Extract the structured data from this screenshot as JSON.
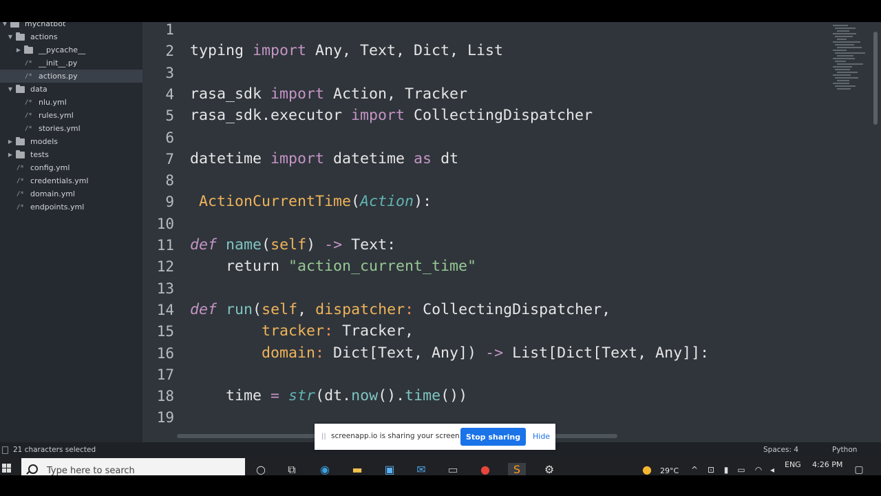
{
  "sidebar": {
    "items": [
      {
        "label": "mychatbot",
        "kind": "folder",
        "open": true,
        "selected": false
      },
      {
        "label": "actions",
        "kind": "folder",
        "open": true,
        "selected": false
      },
      {
        "label": "__pycache__",
        "kind": "folder",
        "open": false,
        "selected": false
      },
      {
        "label": "__init__.py",
        "kind": "file",
        "selected": false
      },
      {
        "label": "actions.py",
        "kind": "file",
        "selected": true
      },
      {
        "label": "data",
        "kind": "folder",
        "open": true,
        "selected": false
      },
      {
        "label": "nlu.yml",
        "kind": "file",
        "selected": false
      },
      {
        "label": "rules.yml",
        "kind": "file",
        "selected": false
      },
      {
        "label": "stories.yml",
        "kind": "file",
        "selected": false
      },
      {
        "label": "models",
        "kind": "folder",
        "open": false,
        "selected": false
      },
      {
        "label": "tests",
        "kind": "folder",
        "open": false,
        "selected": false
      },
      {
        "label": "config.yml",
        "kind": "file",
        "selected": false
      },
      {
        "label": "credentials.yml",
        "kind": "file",
        "selected": false
      },
      {
        "label": "domain.yml",
        "kind": "file",
        "selected": false
      },
      {
        "label": "endpoints.yml",
        "kind": "file",
        "selected": false
      }
    ]
  },
  "editor": {
    "line_numbers": [
      "1",
      "2",
      "3",
      "4",
      "5",
      "6",
      "7",
      "8",
      "9",
      "10",
      "11",
      "12",
      "13",
      "14",
      "15",
      "16",
      "17",
      "18",
      "19"
    ],
    "lines": [
      [],
      [
        {
          "t": "typing ",
          "c": ""
        },
        {
          "t": "import",
          "c": "kw"
        },
        {
          "t": " Any, Text, Dict, List",
          "c": ""
        }
      ],
      [],
      [
        {
          "t": "rasa_sdk ",
          "c": ""
        },
        {
          "t": "import",
          "c": "kw"
        },
        {
          "t": " Action, Tracker",
          "c": ""
        }
      ],
      [
        {
          "t": "rasa_sdk.executor ",
          "c": ""
        },
        {
          "t": "import",
          "c": "kw"
        },
        {
          "t": " CollectingDispatcher",
          "c": ""
        }
      ],
      [],
      [
        {
          "t": "datetime ",
          "c": ""
        },
        {
          "t": "import",
          "c": "kw"
        },
        {
          "t": " datetime ",
          "c": ""
        },
        {
          "t": "as",
          "c": "kw"
        },
        {
          "t": " dt",
          "c": ""
        }
      ],
      [],
      [
        {
          "t": " ",
          "c": ""
        },
        {
          "t": "ActionCurrentTime",
          "c": "cls"
        },
        {
          "t": "(",
          "c": ""
        },
        {
          "t": "Action",
          "c": "it"
        },
        {
          "t": "):",
          "c": ""
        }
      ],
      [],
      [
        {
          "t": "def",
          "c": "itk"
        },
        {
          "t": " ",
          "c": ""
        },
        {
          "t": "name",
          "c": "fn"
        },
        {
          "t": "(",
          "c": ""
        },
        {
          "t": "self",
          "c": "slf"
        },
        {
          "t": ") ",
          "c": ""
        },
        {
          "t": "->",
          "c": "kw"
        },
        {
          "t": " Text:",
          "c": ""
        }
      ],
      [
        {
          "t": "    return ",
          "c": ""
        },
        {
          "t": "\"action_current_time\"",
          "c": "str"
        }
      ],
      [],
      [
        {
          "t": "def",
          "c": "itk"
        },
        {
          "t": " ",
          "c": ""
        },
        {
          "t": "run",
          "c": "fn"
        },
        {
          "t": "(",
          "c": ""
        },
        {
          "t": "self",
          "c": "slf"
        },
        {
          "t": ", ",
          "c": ""
        },
        {
          "t": "dispatcher",
          "c": "slf"
        },
        {
          "t": ":",
          "c": "op"
        },
        {
          "t": " CollectingDispatcher,",
          "c": ""
        }
      ],
      [
        {
          "t": "        ",
          "c": ""
        },
        {
          "t": "tracker",
          "c": "slf"
        },
        {
          "t": ":",
          "c": "op"
        },
        {
          "t": " Tracker,",
          "c": ""
        }
      ],
      [
        {
          "t": "        ",
          "c": ""
        },
        {
          "t": "domain",
          "c": "slf"
        },
        {
          "t": ":",
          "c": "op"
        },
        {
          "t": " Dict[Text, Any]) ",
          "c": ""
        },
        {
          "t": "->",
          "c": "kw"
        },
        {
          "t": " List[Dict[Text, Any]]:",
          "c": ""
        }
      ],
      [],
      [
        {
          "t": "    time ",
          "c": ""
        },
        {
          "t": "=",
          "c": "kw"
        },
        {
          "t": " ",
          "c": ""
        },
        {
          "t": "str",
          "c": "it"
        },
        {
          "t": "(dt.",
          "c": ""
        },
        {
          "t": "now",
          "c": "fn"
        },
        {
          "t": "().",
          "c": ""
        },
        {
          "t": "time",
          "c": "fn"
        },
        {
          "t": "())",
          "c": ""
        }
      ],
      []
    ]
  },
  "statusbar": {
    "left": "21 characters selected",
    "spaces": "Spaces: 4",
    "syntax": "Python"
  },
  "share_banner": {
    "message": "screenapp.io is sharing your screen.",
    "stop_label": "Stop sharing",
    "hide_label": "Hide",
    "grip": "||"
  },
  "taskbar": {
    "search_placeholder": "Type here to search",
    "temperature": "29°C",
    "language": "ENG",
    "time": "4:26 PM"
  },
  "colors": {
    "editor_bg": "#2f353b",
    "sidebar_bg": "#252a30",
    "keyword": "#c594c5",
    "function": "#7fc4c0",
    "class": "#f0b35a",
    "string": "#99c794",
    "accent": "#1a73e8"
  }
}
